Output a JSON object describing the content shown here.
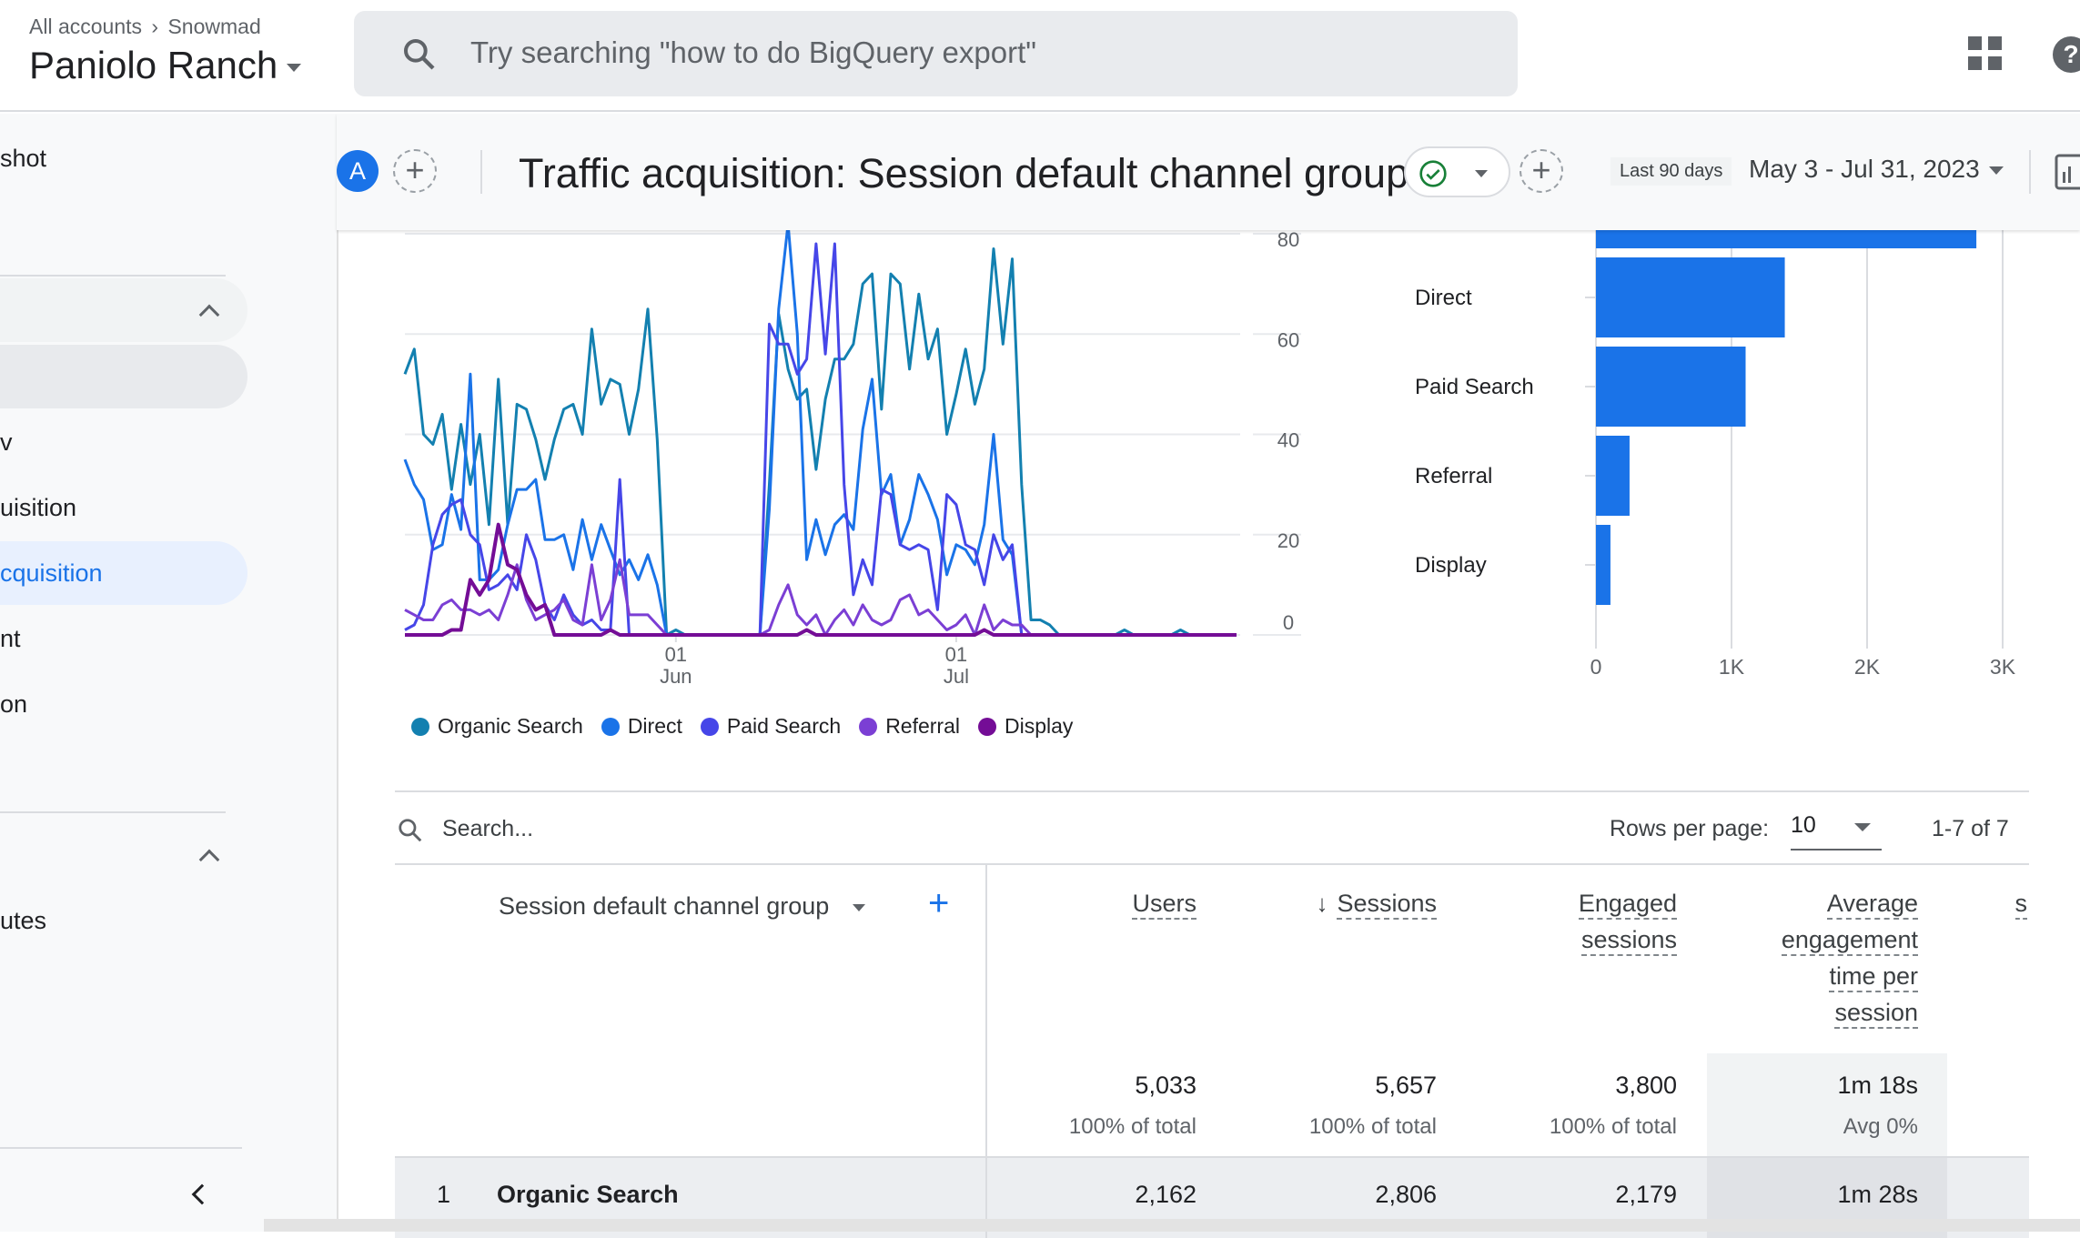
{
  "header": {
    "breadcrumb_all": "All accounts",
    "breadcrumb_account": "Snowmad",
    "property": "Paniolo Ranch",
    "search_placeholder": "Try searching \"how to do BigQuery export\"",
    "icons": [
      "search-icon",
      "apps-grid-icon",
      "help-icon"
    ]
  },
  "sidebar": {
    "items": [
      {
        "label": "shot"
      },
      {
        "label": ""
      },
      {
        "label": ""
      },
      {
        "label": "v"
      },
      {
        "label": "uisition"
      },
      {
        "label": "cquisition",
        "selected": true
      },
      {
        "label": "nt"
      },
      {
        "label": "on"
      },
      {
        "label": ""
      },
      {
        "label": "utes"
      }
    ],
    "collapse_icon": "chevron-left-icon"
  },
  "report": {
    "avatar_letter": "A",
    "title": "Traffic acquisition: Session default channel group",
    "status_icon": "check-circle-icon",
    "date_preset": "Last 90 days",
    "date_range": "May 3 - Jul 31, 2023"
  },
  "colors": {
    "accent": "#1a73e8",
    "organic_search": "#1380b0",
    "direct": "#1a73e8",
    "paid_search": "#4646e8",
    "referral": "#7b3fd4",
    "display": "#740d96",
    "bar": "#1a73e8"
  },
  "chart_data": [
    {
      "type": "line",
      "x_start": "2023-05-03",
      "x_end": "2023-07-31",
      "x_tick_labels": [
        {
          "day": "01",
          "month": "Jun",
          "date": "2023-06-01"
        },
        {
          "day": "01",
          "month": "Jul",
          "date": "2023-07-01"
        }
      ],
      "ylim": [
        0,
        80
      ],
      "y_ticks": [
        0,
        20,
        40,
        60,
        80
      ],
      "grid": true,
      "legend_placement": "bottom-left",
      "series": [
        {
          "name": "Organic Search",
          "values": [
            52,
            57,
            40,
            38,
            44,
            29,
            42,
            30,
            40,
            22,
            51,
            22,
            46,
            45,
            39,
            31,
            39,
            45,
            46,
            40,
            61,
            46,
            51,
            50,
            40,
            49,
            65,
            39,
            0,
            1,
            0,
            0,
            0,
            0,
            0,
            0,
            0,
            0,
            0,
            30,
            64,
            53,
            47,
            49,
            33,
            47,
            55,
            55,
            58,
            70,
            72,
            45,
            72,
            70,
            53,
            68,
            55,
            61,
            40,
            48,
            57,
            46,
            53,
            77,
            58,
            75,
            30,
            3,
            3,
            2,
            0,
            0,
            0,
            0,
            0,
            0,
            0,
            1,
            0,
            0,
            0,
            0,
            0,
            1,
            0,
            0,
            0,
            0,
            0,
            0
          ]
        },
        {
          "name": "Direct",
          "values": [
            35,
            30,
            27,
            17,
            18,
            28,
            21,
            52,
            11,
            11,
            13,
            22,
            29,
            29,
            31,
            19,
            19,
            20,
            13,
            23,
            15,
            22,
            17,
            12,
            15,
            11,
            16,
            10,
            0,
            0,
            0,
            0,
            0,
            0,
            0,
            0,
            0,
            0,
            0,
            25,
            65,
            82,
            60,
            15,
            23,
            16,
            22,
            24,
            21,
            41,
            51,
            28,
            32,
            18,
            23,
            32,
            28,
            23,
            12,
            18,
            17,
            14,
            22,
            40,
            19,
            16,
            0,
            0,
            0,
            0,
            0,
            0,
            0,
            0,
            0,
            0,
            0,
            0,
            0,
            0,
            0,
            0,
            0,
            0,
            0,
            0,
            0,
            0,
            0,
            0
          ]
        },
        {
          "name": "Paid Search",
          "values": [
            1,
            2,
            6,
            18,
            24,
            26,
            27,
            20,
            18,
            9,
            10,
            12,
            9,
            20,
            15,
            6,
            3,
            8,
            4,
            2,
            3,
            1,
            1,
            31,
            0,
            0,
            0,
            0,
            0,
            0,
            0,
            0,
            0,
            0,
            0,
            0,
            0,
            0,
            0,
            62,
            58,
            58,
            52,
            55,
            78,
            56,
            78,
            30,
            8,
            15,
            10,
            29,
            28,
            18,
            17,
            18,
            17,
            5,
            28,
            26,
            18,
            17,
            10,
            20,
            15,
            18,
            0,
            0,
            0,
            0,
            0,
            0,
            0,
            0,
            0,
            0,
            0,
            0,
            0,
            0,
            0,
            0,
            0,
            0,
            0,
            0,
            0,
            0,
            0,
            0
          ]
        },
        {
          "name": "Referral",
          "values": [
            5,
            4,
            3,
            3,
            6,
            7,
            5,
            5,
            4,
            5,
            3,
            8,
            14,
            7,
            3,
            4,
            5,
            7,
            3,
            2,
            14,
            3,
            7,
            15,
            4,
            4,
            4,
            2,
            0,
            0,
            0,
            0,
            0,
            0,
            0,
            0,
            0,
            0,
            0,
            1,
            6,
            10,
            4,
            2,
            4,
            0,
            3,
            5,
            2,
            6,
            3,
            2,
            3,
            7,
            8,
            4,
            5,
            3,
            1,
            2,
            4,
            0,
            6,
            1,
            3,
            2,
            2,
            0,
            0,
            0,
            0,
            0,
            0,
            0,
            0,
            0,
            0,
            0,
            0,
            0,
            0,
            0,
            0,
            0,
            0,
            0,
            0,
            0,
            0,
            0
          ]
        },
        {
          "name": "Display",
          "values": [
            0,
            0,
            0,
            0,
            0,
            1,
            1,
            11,
            8,
            11,
            22,
            14,
            13,
            8,
            5,
            6,
            0,
            0,
            0,
            0,
            0,
            0,
            1,
            0,
            0,
            0,
            0,
            0,
            0,
            0,
            0,
            0,
            0,
            0,
            0,
            0,
            0,
            0,
            0,
            0,
            0,
            0,
            0,
            1,
            0,
            0,
            0,
            0,
            0,
            0,
            0,
            0,
            0,
            0,
            0,
            0,
            0,
            0,
            0,
            0,
            0,
            0,
            1,
            0,
            0,
            0,
            0,
            0,
            0,
            0,
            0,
            0,
            0,
            0,
            0,
            0,
            0,
            0,
            0,
            0,
            0,
            0,
            0,
            0,
            0,
            0,
            0,
            0,
            0,
            0
          ]
        }
      ]
    },
    {
      "type": "bar",
      "orientation": "horizontal",
      "bars": [
        {
          "label": null,
          "value": 2806
        },
        {
          "label": "Direct",
          "value": 1393
        },
        {
          "label": "Paid Search",
          "value": 1104
        },
        {
          "label": "Referral",
          "value": 248
        },
        {
          "label": "Display",
          "value": 107
        }
      ],
      "x_ticks": [
        "0",
        "1K",
        "2K",
        "3K"
      ],
      "xlim": [
        0,
        3000
      ],
      "grid": true
    }
  ],
  "table": {
    "search_placeholder": "Search...",
    "rows_per_page_label": "Rows per page:",
    "rows_per_page": "10",
    "pagination": "1-7 of 7",
    "dimension_header": "Session default channel group",
    "columns": [
      {
        "lines": [
          "Users"
        ],
        "total": "5,033",
        "sub": "100% of total"
      },
      {
        "lines": [
          "Sessions"
        ],
        "sorted": "descending",
        "total": "5,657",
        "sub": "100% of total"
      },
      {
        "lines": [
          "Engaged",
          "sessions"
        ],
        "total": "3,800",
        "sub": "100% of total"
      },
      {
        "lines": [
          "Average",
          "engagement",
          "time per",
          "session"
        ],
        "total": "1m 18s",
        "sub": "Avg 0%"
      },
      {
        "lines": [
          "s"
        ]
      }
    ],
    "rows": [
      {
        "index": "1",
        "name": "Organic Search",
        "values": [
          "2,162",
          "2,806",
          "2,179",
          "1m 28s"
        ]
      }
    ]
  }
}
